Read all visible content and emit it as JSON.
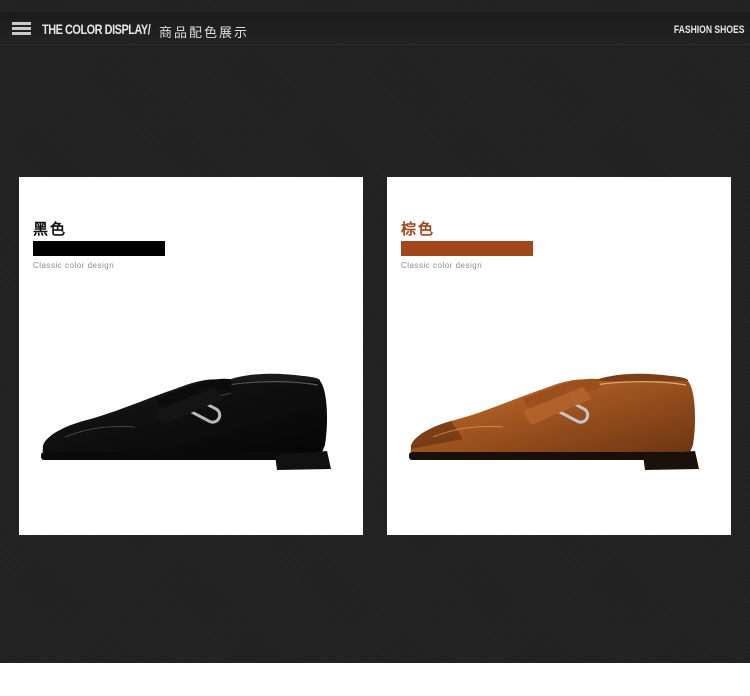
{
  "header": {
    "title_en": "THE COLOR DISPLAY/",
    "title_cn": "商品配色展示",
    "brand": "FASHION SHOES"
  },
  "cards": [
    {
      "color_name": "黑色",
      "swatch_color": "#000000",
      "caption": "Classic color design",
      "shoe_color": "black"
    },
    {
      "color_name": "棕色",
      "swatch_color": "#a0481c",
      "caption": "Classic color design",
      "shoe_color": "brown"
    }
  ],
  "colors": {
    "background": "#222222",
    "black_label": "#111111",
    "brown_label": "#a0481c",
    "brown_leather": "#b9652a"
  }
}
